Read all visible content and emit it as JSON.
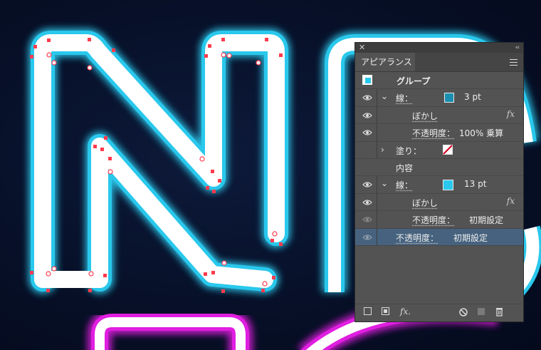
{
  "panel": {
    "title": "アピアランス",
    "rows": [
      {
        "label": "グループ"
      },
      {
        "label": "線：",
        "value": "3 pt",
        "color": "#1a8fb0"
      },
      {
        "label": "ぼかし",
        "fx": "fx"
      },
      {
        "label": "不透明度：",
        "value": "100% 乗算"
      },
      {
        "label": "塗り："
      },
      {
        "label": "内容"
      },
      {
        "label": "線：",
        "value": "13 pt",
        "color": "#29c8ec"
      },
      {
        "label": "ぼかし",
        "fx": "fx"
      },
      {
        "label": "不透明度：",
        "value": "初期設定"
      },
      {
        "label": "不透明度：",
        "value": "初期設定"
      }
    ],
    "bottom_fx": "fx."
  },
  "colors": {
    "neon_cyan": "#29c8ec",
    "neon_magenta": "#e01ee0",
    "anchor_red": "#ff3b4d",
    "selection_row": "#46627e"
  }
}
